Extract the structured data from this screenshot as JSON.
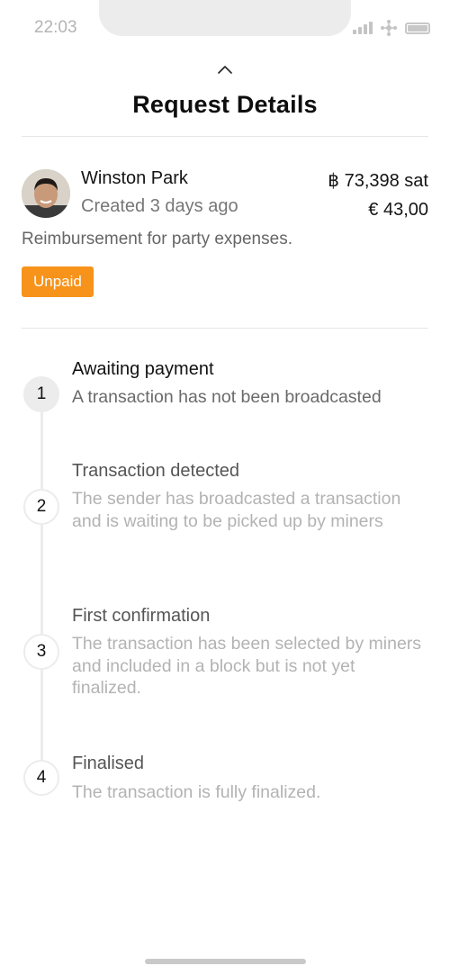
{
  "status_bar": {
    "time": "22:03"
  },
  "header": {
    "title": "Request Details"
  },
  "request": {
    "user_name": "Winston Park",
    "created": "Created 3 days ago",
    "amount_btc": "฿ 73,398 sat",
    "amount_fiat": "€ 43,00",
    "description": "Reimbursement for party expenses.",
    "status": "Unpaid",
    "status_color": "#f7931a"
  },
  "steps": [
    {
      "number": "1",
      "title": "Awaiting payment",
      "description": "A transaction has not been broadcasted"
    },
    {
      "number": "2",
      "title": "Transaction detected",
      "description": "The sender has broadcasted a transaction and is waiting to be picked up by miners"
    },
    {
      "number": "3",
      "title": "First confirmation",
      "description": "The transaction has been selected by miners and included in a block but is not yet finalized."
    },
    {
      "number": "4",
      "title": "Finalised",
      "description": "The transaction is fully finalized."
    }
  ]
}
